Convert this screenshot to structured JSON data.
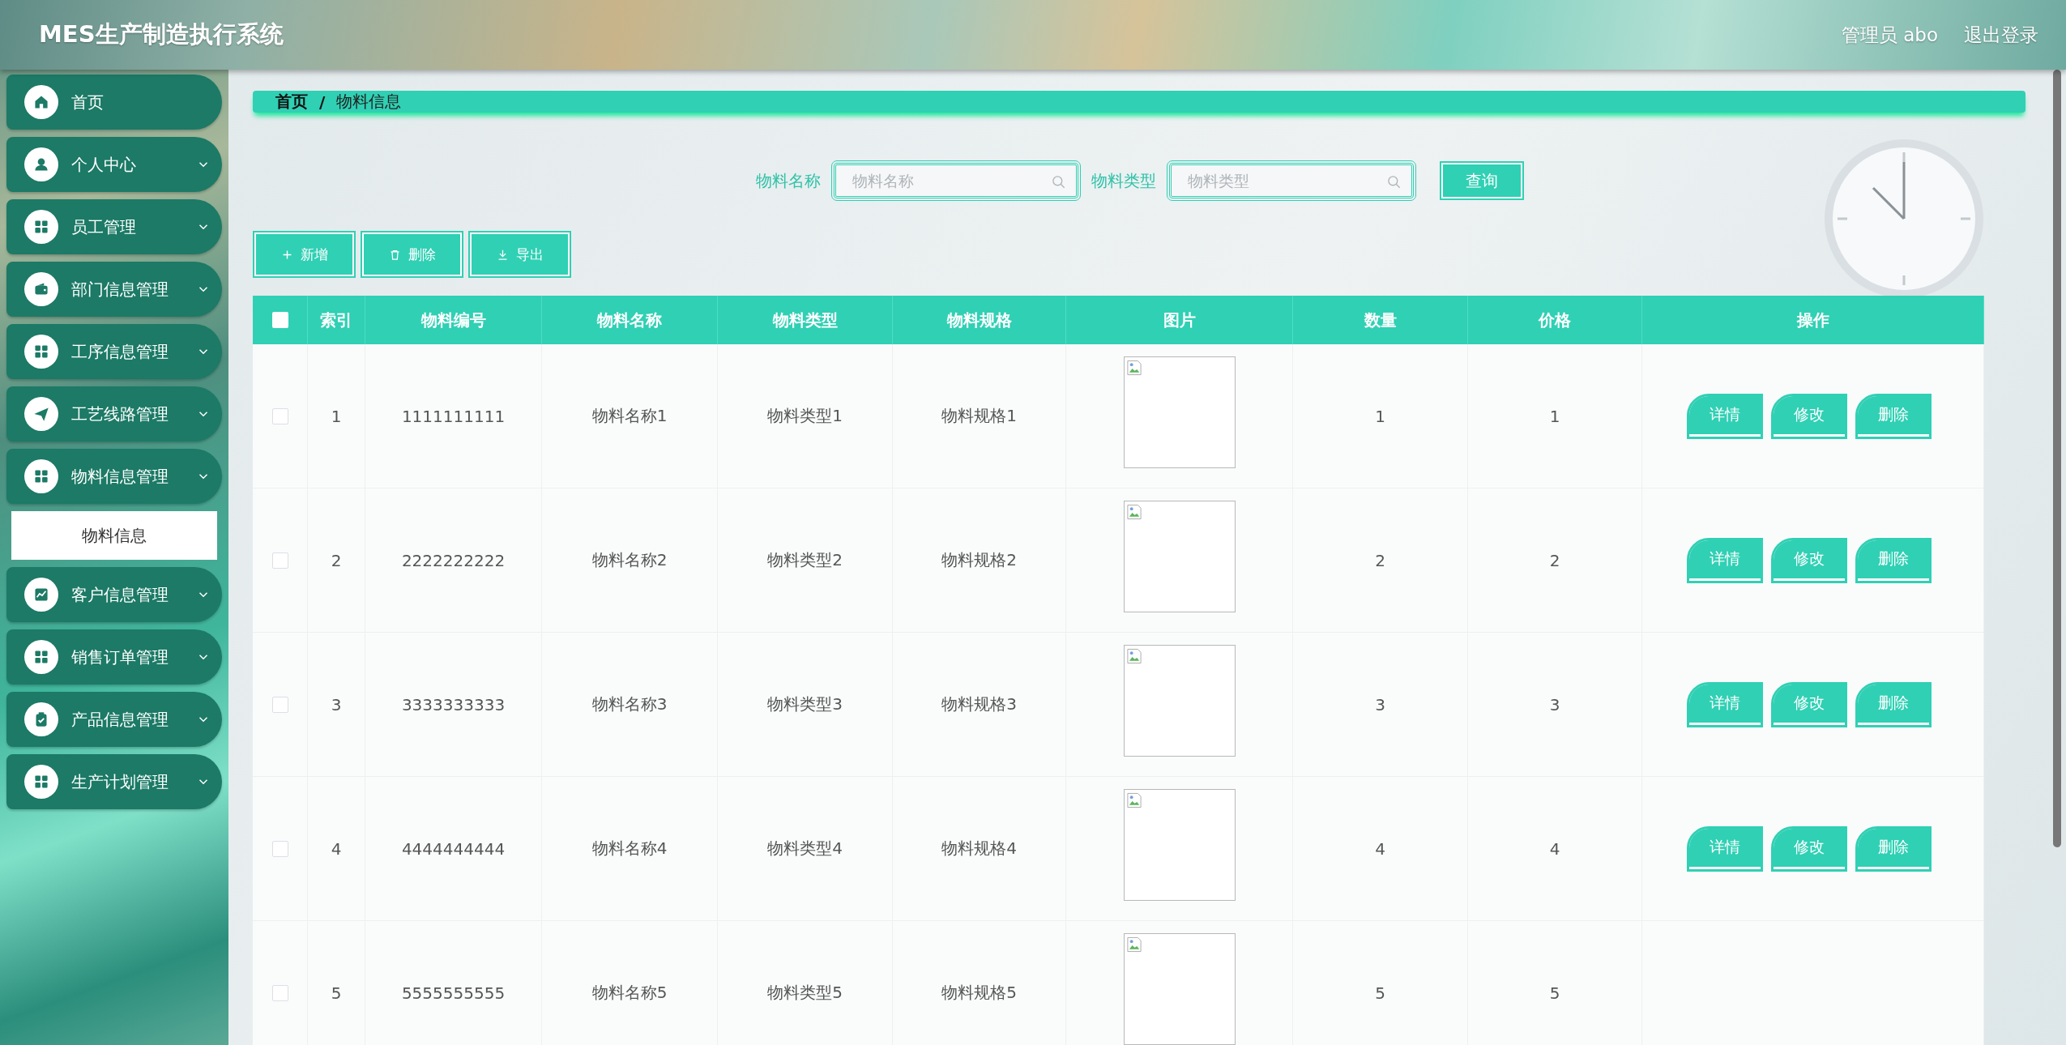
{
  "header": {
    "title": "MES生产制造执行系统",
    "user": "管理员 abo",
    "logout": "退出登录"
  },
  "sidebar": {
    "items": [
      {
        "label": "首页",
        "kind": "link"
      },
      {
        "label": "个人中心",
        "kind": "menu"
      },
      {
        "label": "员工管理",
        "kind": "menu"
      },
      {
        "label": "部门信息管理",
        "kind": "menu"
      },
      {
        "label": "工序信息管理",
        "kind": "menu"
      },
      {
        "label": "工艺线路管理",
        "kind": "menu"
      },
      {
        "label": "物料信息管理",
        "kind": "menu",
        "children": [
          {
            "label": "物料信息",
            "selected": true
          }
        ]
      },
      {
        "label": "客户信息管理",
        "kind": "menu"
      },
      {
        "label": "销售订单管理",
        "kind": "menu"
      },
      {
        "label": "产品信息管理",
        "kind": "menu"
      },
      {
        "label": "生产计划管理",
        "kind": "menu"
      }
    ]
  },
  "breadcrumb": {
    "items": [
      "首页",
      "物料信息"
    ],
    "separator": "/"
  },
  "search": {
    "fields": [
      {
        "label": "物料名称",
        "placeholder": "物料名称"
      },
      {
        "label": "物料类型",
        "placeholder": "物料类型"
      }
    ],
    "button": "查询"
  },
  "toolbar": [
    "新增",
    "删除",
    "导出"
  ],
  "table": {
    "select_all": false,
    "columns": [
      "索引",
      "物料编号",
      "物料名称",
      "物料类型",
      "物料规格",
      "图片",
      "数量",
      "价格",
      "操作"
    ],
    "rows": [
      {
        "checked": false,
        "cells": [
          "1",
          "1111111111",
          "物料名称1",
          "物料类型1",
          "物料规格1",
          {
            "kind": "broken_image"
          },
          "1",
          "1"
        ],
        "actions": [
          "详情",
          "修改",
          "删除"
        ]
      },
      {
        "checked": false,
        "cells": [
          "2",
          "2222222222",
          "物料名称2",
          "物料类型2",
          "物料规格2",
          {
            "kind": "broken_image"
          },
          "2",
          "2"
        ],
        "actions": [
          "详情",
          "修改",
          "删除"
        ]
      },
      {
        "checked": false,
        "cells": [
          "3",
          "3333333333",
          "物料名称3",
          "物料类型3",
          "物料规格3",
          {
            "kind": "broken_image"
          },
          "3",
          "3"
        ],
        "actions": [
          "详情",
          "修改",
          "删除"
        ]
      },
      {
        "checked": false,
        "cells": [
          "4",
          "4444444444",
          "物料名称4",
          "物料类型4",
          "物料规格4",
          {
            "kind": "broken_image"
          },
          "4",
          "4"
        ],
        "actions": [
          "详情",
          "修改",
          "删除"
        ]
      },
      {
        "checked": false,
        "cells": [
          "5",
          "5555555555",
          "物料名称5",
          "物料类型5",
          "物料规格5",
          {
            "kind": "broken_image"
          },
          "5",
          "5"
        ]
      }
    ]
  }
}
